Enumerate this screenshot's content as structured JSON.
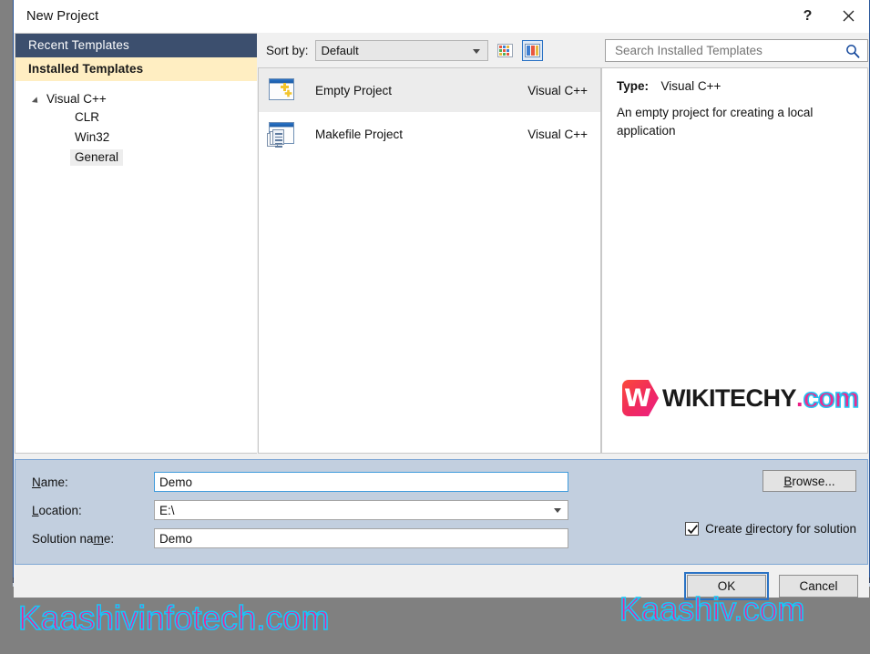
{
  "window": {
    "title": "New Project",
    "help_label": "?",
    "close_label": "✕"
  },
  "left_pane": {
    "recent_header": "Recent Templates",
    "installed_header": "Installed Templates",
    "tree": {
      "root_label": "Visual C++",
      "children": [
        {
          "label": "CLR",
          "selected": false
        },
        {
          "label": "Win32",
          "selected": false
        },
        {
          "label": "General",
          "selected": true
        }
      ]
    }
  },
  "center_pane": {
    "sort_label": "Sort by:",
    "sort_value": "Default",
    "sort_options": [
      "Default"
    ],
    "view_small_icons": "small-icons-view",
    "view_large_icons": "large-icons-view",
    "templates": [
      {
        "name": "Empty Project",
        "language": "Visual C++",
        "selected": true
      },
      {
        "name": "Makefile Project",
        "language": "Visual C++",
        "selected": false
      }
    ]
  },
  "right_pane": {
    "search_placeholder": "Search Installed Templates",
    "search_value": "",
    "type_label": "Type:",
    "type_value": "Visual C++",
    "description": "An empty project for creating a local application",
    "logo": {
      "badge_letter": "W",
      "word": "WIKITECHY",
      "dot": ".",
      "com": "com"
    }
  },
  "form": {
    "name_label_pre": "",
    "name_label_acc": "N",
    "name_label_post": "ame:",
    "name_value": "Demo",
    "location_label_acc": "L",
    "location_label_post": "ocation:",
    "location_value": "E:\\",
    "solution_label_pre": "Solution na",
    "solution_label_acc": "m",
    "solution_label_post": "e:",
    "solution_value": "Demo",
    "browse_pre": "",
    "browse_acc": "B",
    "browse_post": "rowse...",
    "createdir_pre": "Create ",
    "createdir_acc": "d",
    "createdir_post": "irectory for solution",
    "createdir_checked": true
  },
  "buttons": {
    "ok": "OK",
    "cancel": "Cancel"
  },
  "watermarks": {
    "left": "Kaashivinfotech.com",
    "right": "Kaashiv.com"
  },
  "colors": {
    "accent_blue": "#2a72c4",
    "header_navy": "#3c4f6e",
    "header_cream": "#ffeec2",
    "form_bg": "#c2cfdf",
    "watermark_pink": "#f0258d",
    "watermark_cyan": "#17c8f7",
    "logo_magenta": "#ec1f86",
    "backdrop_navy": "#2d3c5c"
  }
}
